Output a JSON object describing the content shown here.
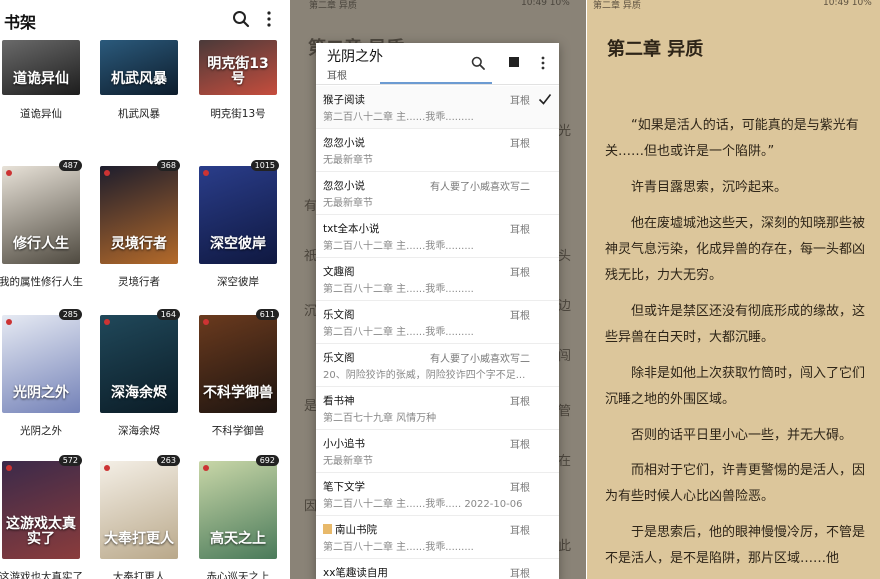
{
  "bookshelf": {
    "title": "书架",
    "books": [
      {
        "name": "道诡异仙",
        "cover_text": "道诡异仙",
        "badge": "",
        "colors": [
          "#6a6a6a",
          "#1d1d1d"
        ]
      },
      {
        "name": "机武风暴",
        "cover_text": "机武风暴",
        "badge": "",
        "colors": [
          "#2b5a7c",
          "#0d1c2b"
        ]
      },
      {
        "name": "明克街13号",
        "cover_text": "明克街13号",
        "badge": "",
        "colors": [
          "#4a3a3a",
          "#c64d3d"
        ]
      },
      {
        "name": "我的属性修行人生",
        "cover_text": "修行人生",
        "badge": "487",
        "colors": [
          "#e8e2d8",
          "#4f4a40"
        ]
      },
      {
        "name": "灵境行者",
        "cover_text": "灵境行者",
        "badge": "368",
        "colors": [
          "#1d1d2d",
          "#b46a2a"
        ]
      },
      {
        "name": "深空彼岸",
        "cover_text": "深空彼岸",
        "badge": "1015",
        "colors": [
          "#2a3d8a",
          "#0f1840"
        ]
      },
      {
        "name": "光阴之外",
        "cover_text": "光阴之外",
        "badge": "285",
        "colors": [
          "#e6eaf3",
          "#7482b8"
        ]
      },
      {
        "name": "深海余烬",
        "cover_text": "深海余烬",
        "badge": "164",
        "colors": [
          "#20485a",
          "#0b1c26"
        ]
      },
      {
        "name": "不科学御兽",
        "cover_text": "不科学御兽",
        "badge": "611",
        "colors": [
          "#6a3a1e",
          "#1d1410"
        ]
      },
      {
        "name": "这游戏也太真实了",
        "cover_text": "这游戏太真实了",
        "badge": "572",
        "colors": [
          "#3b2a4a",
          "#8a3c3c"
        ]
      },
      {
        "name": "大奉打更人",
        "cover_text": "大奉打更人",
        "badge": "263",
        "colors": [
          "#f4efe6",
          "#b9a88a"
        ]
      },
      {
        "name": "赤心巡天之上",
        "cover_text": "高天之上",
        "badge": "692",
        "colors": [
          "#c9d7a8",
          "#4a7a5a"
        ]
      }
    ]
  },
  "source_dialog": {
    "status_left": "第二章 异质",
    "status_right": "10:49 10%",
    "bg_title": "第二章 异质",
    "bg_chars": [
      "光",
      "有",
      "头",
      "祇",
      "边",
      "沉",
      "闯",
      "是",
      "管",
      "在",
      "因",
      "此"
    ],
    "title": "光阴之外",
    "author": "耳根",
    "sources": [
      {
        "name": "猴子阅读",
        "author": "耳根",
        "chapter": "第二百八十二章 主......我乖.........",
        "selected": true,
        "icon": false
      },
      {
        "name": "忽忽小说",
        "author": "耳根",
        "chapter": "无最新章节",
        "selected": false,
        "icon": false
      },
      {
        "name": "忽忽小说",
        "author": "有人要了小威喜欢写二",
        "chapter": "无最新章节",
        "selected": false,
        "icon": false
      },
      {
        "name": "txt全本小说",
        "author": "耳根",
        "chapter": "第二百八十二章 主......我乖.........",
        "selected": false,
        "icon": false
      },
      {
        "name": "文趣阁",
        "author": "耳根",
        "chapter": "第二百八十二章 主......我乖.........",
        "selected": false,
        "icon": false
      },
      {
        "name": "乐文阁",
        "author": "耳根",
        "chapter": "第二百八十二章 主......我乖.........",
        "selected": false,
        "icon": false
      },
      {
        "name": "乐文阁",
        "author": "有人要了小威喜欢写二",
        "chapter": "20、阴险狡诈的张威，阴险狡诈四个字不足...",
        "selected": false,
        "icon": false
      },
      {
        "name": "看书神",
        "author": "耳根",
        "chapter": "第二百七十九章 风情万种",
        "selected": false,
        "icon": false
      },
      {
        "name": "小小追书",
        "author": "耳根",
        "chapter": "无最新章节",
        "selected": false,
        "icon": false
      },
      {
        "name": "笔下文学",
        "author": "耳根",
        "chapter": "第二百八十二章 主......我乖..... 2022-10-06",
        "selected": false,
        "icon": false
      },
      {
        "name": "南山书院",
        "author": "耳根",
        "chapter": "第二百八十二章 主......我乖.........",
        "selected": false,
        "icon": true
      },
      {
        "name": "xx笔趣读自用",
        "author": "耳根",
        "chapter": "",
        "selected": false,
        "icon": false
      }
    ]
  },
  "reader": {
    "status_left": "第二章 异质",
    "status_right": "10:49 10%",
    "chapter_title": "第二章 异质",
    "paragraphs": [
      "“如果是活人的话，可能真的是与紫光有关……但也或许是一个陷阱。”",
      "许青目露思索，沉吟起来。",
      "他在废墟城池这些天，深刻的知晓那些被神灵气息污染，化成异兽的存在，每一头都凶残无比，力大无穷。",
      "但或许是禁区还没有彻底形成的缘故，这些异兽在白天时，大都沉睡。",
      "除非是如他上次获取竹筒时，闯入了它们沉睡之地的外围区域。",
      "否则的话平日里小心一些，并无大碍。",
      "而相对于它们，许青更警惕的是活人，因为有些时候人心比凶兽险恶。",
      "于是思索后，他的眼神慢慢冷厉，不管是不是活人，是不是陷阱，那片区域……他"
    ]
  }
}
